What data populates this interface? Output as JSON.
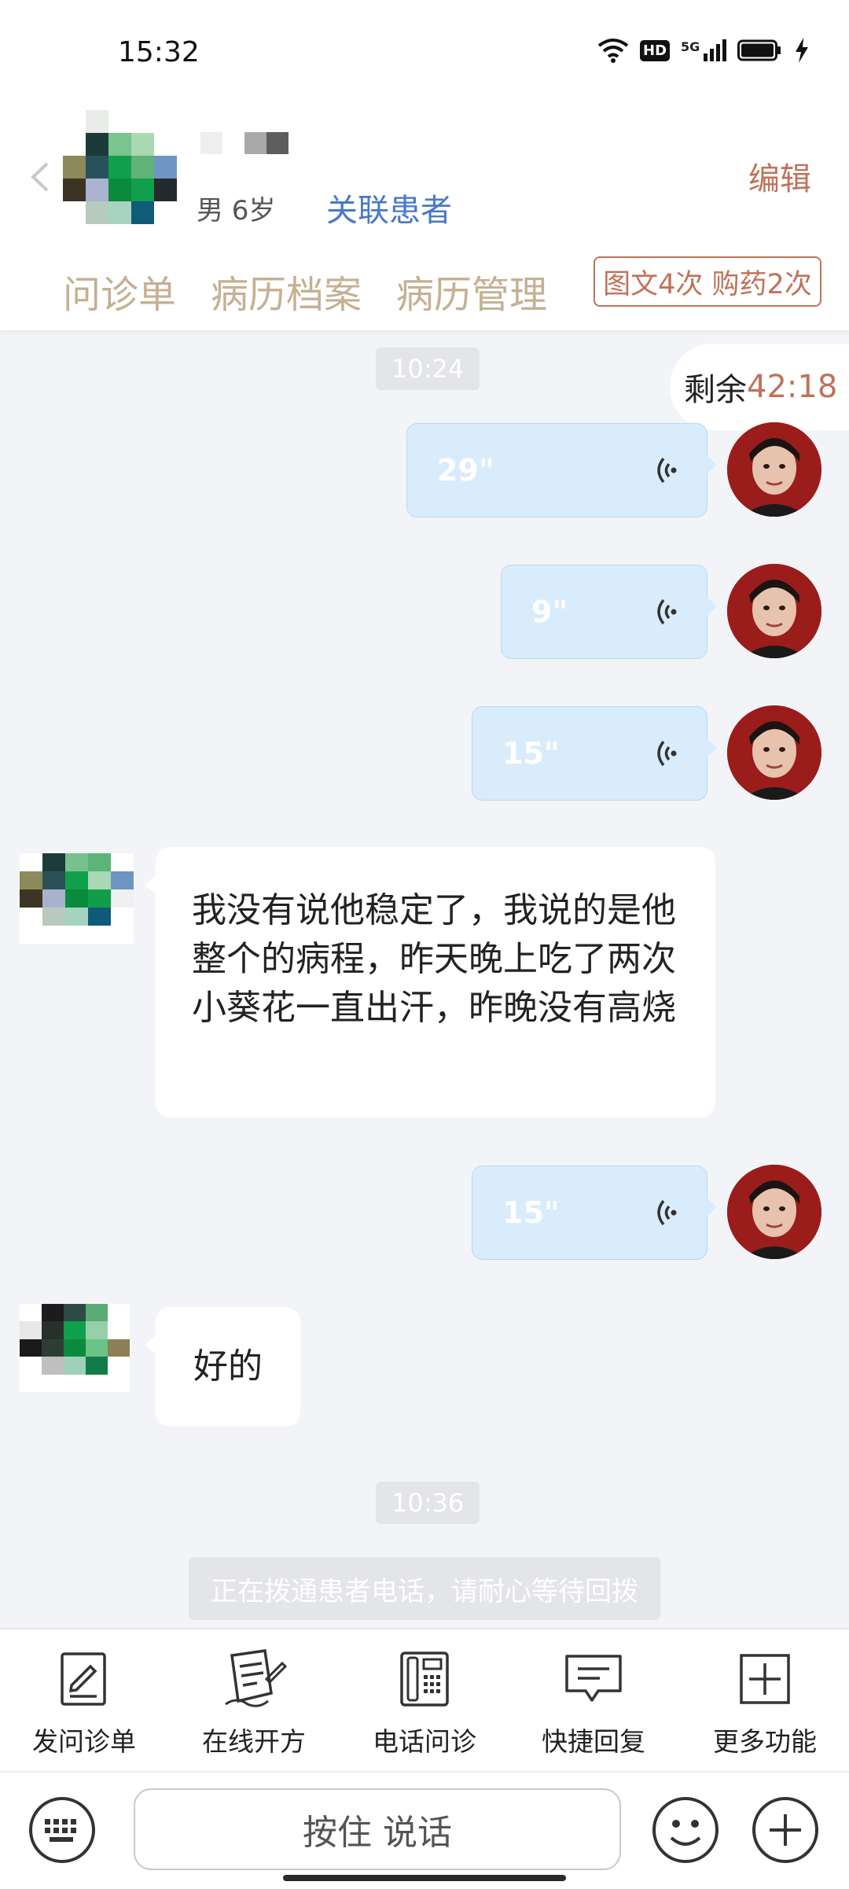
{
  "status_bar": {
    "time": "15:32",
    "network": "5G",
    "hd": "HD"
  },
  "header": {
    "patient_meta": "男 6岁",
    "link_patient": "关联患者",
    "edit": "编辑",
    "tabs": [
      "问诊单",
      "病历档案",
      "病历管理"
    ],
    "quota": "图文4次 购药2次"
  },
  "chat": {
    "time1": "10:24",
    "remain_label": "剩余",
    "remain_value": "42:18",
    "voice": [
      "29\"",
      "9\"",
      "15\"",
      "15\""
    ],
    "patient_msg1": "我没有说他稳定了，我说的是他整个的病程，昨天晚上吃了两次小葵花一直出汗，昨晚没有高烧",
    "patient_msg2": "好的",
    "time2": "10:36",
    "system_note": "正在拨通患者电话，请耐心等待回拨"
  },
  "toolbar": {
    "items": [
      {
        "label": "发问诊单",
        "icon": "form-edit-icon"
      },
      {
        "label": "在线开方",
        "icon": "prescription-icon"
      },
      {
        "label": "电话问诊",
        "icon": "phone-icon"
      },
      {
        "label": "快捷回复",
        "icon": "quick-reply-icon"
      },
      {
        "label": "更多功能",
        "icon": "more-plus-icon"
      }
    ]
  },
  "input": {
    "hold_to_talk": "按住 说话"
  },
  "colors": {
    "accent": "#c0725a",
    "link": "#4a78c8",
    "tab": "#c5b091",
    "voice_bubble": "#d9ecfb"
  }
}
